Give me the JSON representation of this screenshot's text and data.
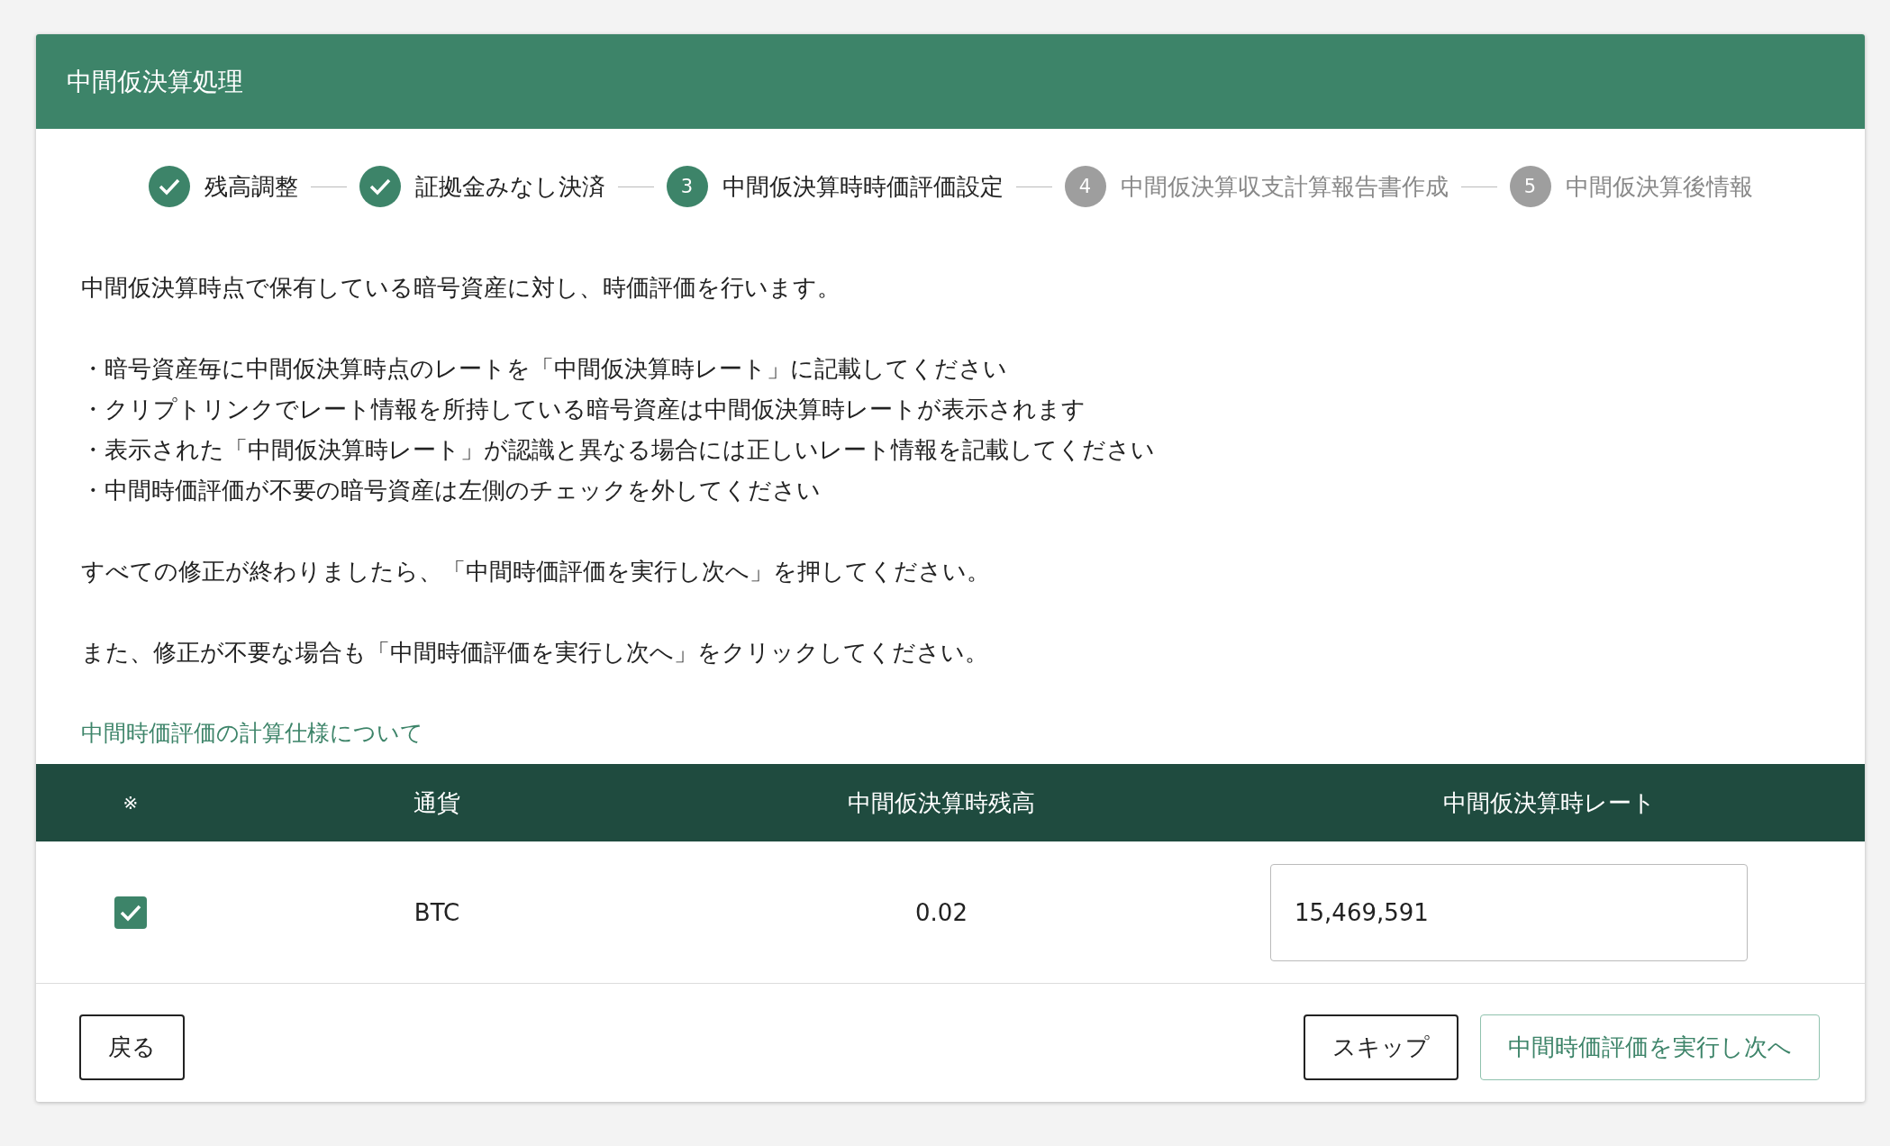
{
  "header": {
    "title": "中間仮決算処理"
  },
  "steps": [
    {
      "label": "残高調整",
      "completed": true
    },
    {
      "label": "証拠金みなし決済",
      "completed": true
    },
    {
      "label": "中間仮決算時時価評価設定",
      "number": "3",
      "completed": false,
      "current": true
    },
    {
      "label": "中間仮決算収支計算報告書作成",
      "number": "4",
      "completed": false,
      "current": false
    },
    {
      "label": "中間仮決算後情報",
      "number": "5",
      "completed": false,
      "current": false
    }
  ],
  "intro": "中間仮決算時点で保有している暗号資産に対し、時価評価を行います。",
  "bullets": [
    "・暗号資産毎に中間仮決算時点のレートを「中間仮決算時レート」に記載してください",
    "・クリプトリンクでレート情報を所持している暗号資産は中間仮決算時レートが表示されます",
    "・表示された「中間仮決算時レート」が認識と異なる場合には正しいレート情報を記載してください",
    "・中間時価評価が不要の暗号資産は左側のチェックを外してください"
  ],
  "notes": [
    "すべての修正が終わりましたら、「中間時価評価を実行し次へ」を押してください。",
    "また、修正が不要な場合も「中間時価評価を実行し次へ」をクリックしてください。"
  ],
  "spec_link": "中間時価評価の計算仕様について",
  "table": {
    "columns": [
      "※",
      "通貨",
      "中間仮決算時残高",
      "中間仮決算時レート"
    ],
    "rows": [
      {
        "checked": true,
        "currency": "BTC",
        "balance": "0.02",
        "rate": "15,469,591"
      }
    ]
  },
  "buttons": {
    "back": "戻る",
    "skip": "スキップ",
    "next": "中間時価評価を実行し次へ"
  }
}
